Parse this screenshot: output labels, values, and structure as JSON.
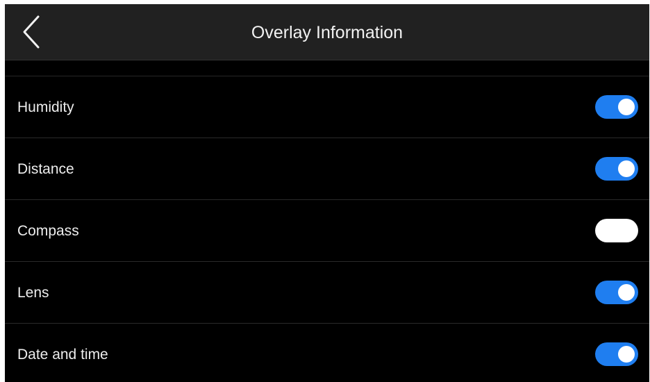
{
  "header": {
    "title": "Overlay Information",
    "back_icon": "chevron-left-icon"
  },
  "colors": {
    "toggle_on": "#1f7ef0",
    "toggle_off": "#ffffff",
    "background": "#000000",
    "header_bg": "#212121"
  },
  "settings": [
    {
      "label": "Humidity",
      "enabled": true
    },
    {
      "label": "Distance",
      "enabled": true
    },
    {
      "label": "Compass",
      "enabled": false
    },
    {
      "label": "Lens",
      "enabled": true
    },
    {
      "label": "Date and time",
      "enabled": true
    }
  ]
}
